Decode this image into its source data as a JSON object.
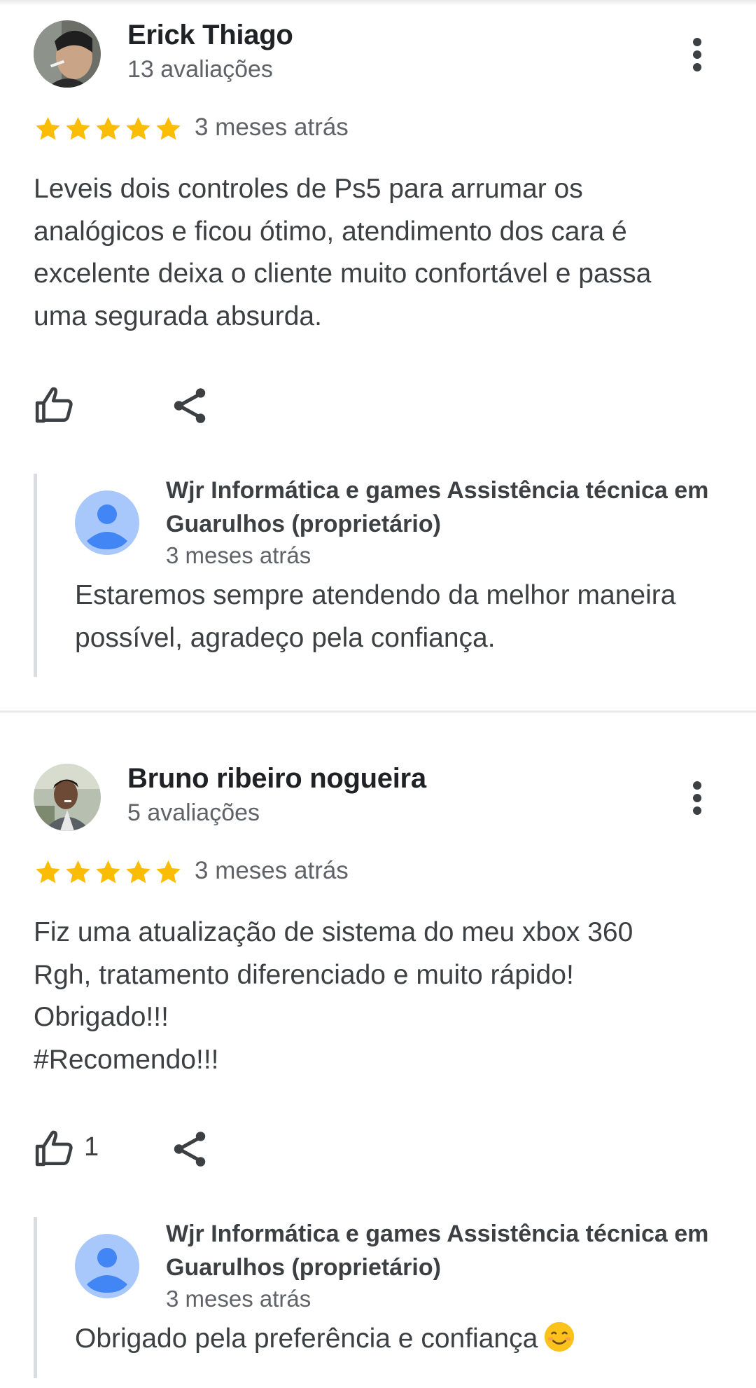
{
  "reviews": [
    {
      "name": "Erick Thiago",
      "review_count": "13 avaliações",
      "rating": 5,
      "date": "3 meses atrás",
      "text": "Leveis dois controles de Ps5 para arrumar os\nanalógicos e ficou ótimo, atendimento dos cara é\nexcelente deixa o cliente muito confortável e passa\numa segurada absurda.",
      "likes": "",
      "reply": {
        "owner_name": "Wjr Informática e games Assistência técnica em\nGuarulhos (proprietário)",
        "date": "3 meses atrás",
        "text": "Estaremos sempre atendendo da melhor maneira possível, agradeço pela confiança."
      }
    },
    {
      "name": "Bruno ribeiro nogueira",
      "review_count": "5 avaliações",
      "rating": 5,
      "date": "3 meses atrás",
      "text": "Fiz uma atualização de sistema do meu xbox 360\nRgh, tratamento diferenciado e muito rápido!\nObrigado!!!\n#Recomendo!!!",
      "likes": "1",
      "reply": {
        "owner_name": "Wjr Informática e games Assistência técnica em\nGuarulhos (proprietário)",
        "date": "3 meses atrás",
        "text": "Obrigado pela preferência e confiança",
        "emoji": "smiling-face-emoji"
      }
    }
  ],
  "icons": {
    "star": "star-icon",
    "like": "thumbs-up-icon",
    "share": "share-icon",
    "menu": "more-vert-icon",
    "owner": "person-avatar-icon"
  },
  "colors": {
    "star": "#fbbc04",
    "owner_avatar_bg": "#a8c7fa",
    "owner_avatar_fg": "#4285f4",
    "text": "#3c4043",
    "muted": "#5f6368"
  }
}
